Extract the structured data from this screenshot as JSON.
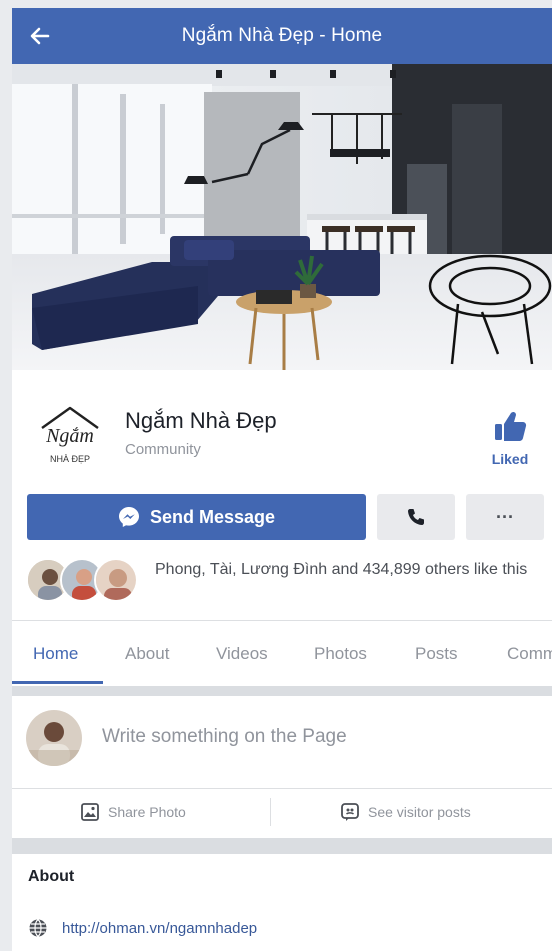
{
  "header": {
    "title": "Ngắm Nhà Đẹp - Home",
    "back_icon": "arrow-left-icon"
  },
  "profile": {
    "name": "Ngắm Nhà Đẹp",
    "category": "Community",
    "liked_label": "Liked",
    "logo_text_script": "Ngắm",
    "logo_text_sub": "NHÀ ĐẸP"
  },
  "actions": {
    "send_message_label": "Send Message",
    "call_icon": "phone-icon",
    "more_label": "···"
  },
  "likes": {
    "text": "Phong, Tài, Lương Đình and 434,899 others like this"
  },
  "tabs": [
    "Home",
    "About",
    "Videos",
    "Photos",
    "Posts",
    "Comm"
  ],
  "composer": {
    "placeholder": "Write something on the Page",
    "share_photo_label": "Share Photo",
    "see_visitor_posts_label": "See visitor posts"
  },
  "about": {
    "title": "About",
    "website": "http://ohman.vn/ngamnhadep"
  },
  "colors": {
    "brand": "#4267b2",
    "link": "#385898",
    "muted": "#90949c"
  }
}
